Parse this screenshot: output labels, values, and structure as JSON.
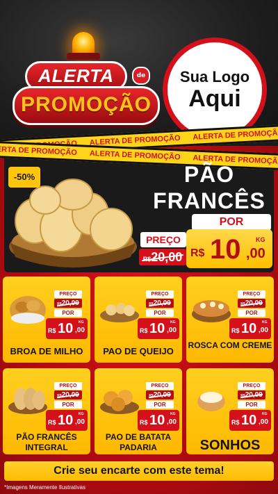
{
  "header": {
    "badge_alerta": "ALERTA",
    "badge_de": "de",
    "badge_promocao": "PROMOÇÃO",
    "logo_line1": "Sua Logo",
    "logo_line2": "Aqui",
    "tape_text": "ALERTA DE PROMOÇÃO"
  },
  "main_offer": {
    "discount": "-50%",
    "title_line1": "PÃO",
    "title_line2": "FRANCÊS",
    "preco_label": "PREÇO",
    "old_currency": "R$",
    "old_price": "20,00",
    "por_label": "POR",
    "currency": "R$",
    "price_int": "10",
    "price_dec": ",00",
    "unit": "KG"
  },
  "price_labels": {
    "preco": "PREÇO",
    "por": "POR",
    "currency": "R$",
    "unit": "KG"
  },
  "products": [
    {
      "name": "BROA DE MILHO",
      "old_price": "20,00",
      "price_int": "10",
      "price_dec": ",00",
      "image": "broa-icon"
    },
    {
      "name": "PAO DE QUEIJO",
      "old_price": "20,00",
      "price_int": "10",
      "price_dec": ",00",
      "image": "pao-de-queijo-icon"
    },
    {
      "name": "ROSCA COM CREME",
      "old_price": "20,00",
      "price_int": "10",
      "price_dec": ",00",
      "image": "rosca-icon"
    },
    {
      "name": "PÃO FRANCÊS INTEGRAL",
      "old_price": "20,00",
      "price_int": "10",
      "price_dec": ",00",
      "image": "pao-integral-icon"
    },
    {
      "name": "PAO DE BATATA PADARIA",
      "old_price": "20,00",
      "price_int": "10",
      "price_dec": ",00",
      "image": "pao-batata-icon"
    },
    {
      "name": "SONHOS",
      "old_price": "20,00",
      "price_int": "10",
      "price_dec": ",00",
      "image": "sonho-icon"
    }
  ],
  "footer": {
    "cta": "Crie seu encarte com este tema!",
    "disclaimer": "*Imagens Meramente Ilustrativas"
  },
  "colors": {
    "red": "#d4111a",
    "yellow": "#ffc40c",
    "dark": "#1a1a1a"
  }
}
